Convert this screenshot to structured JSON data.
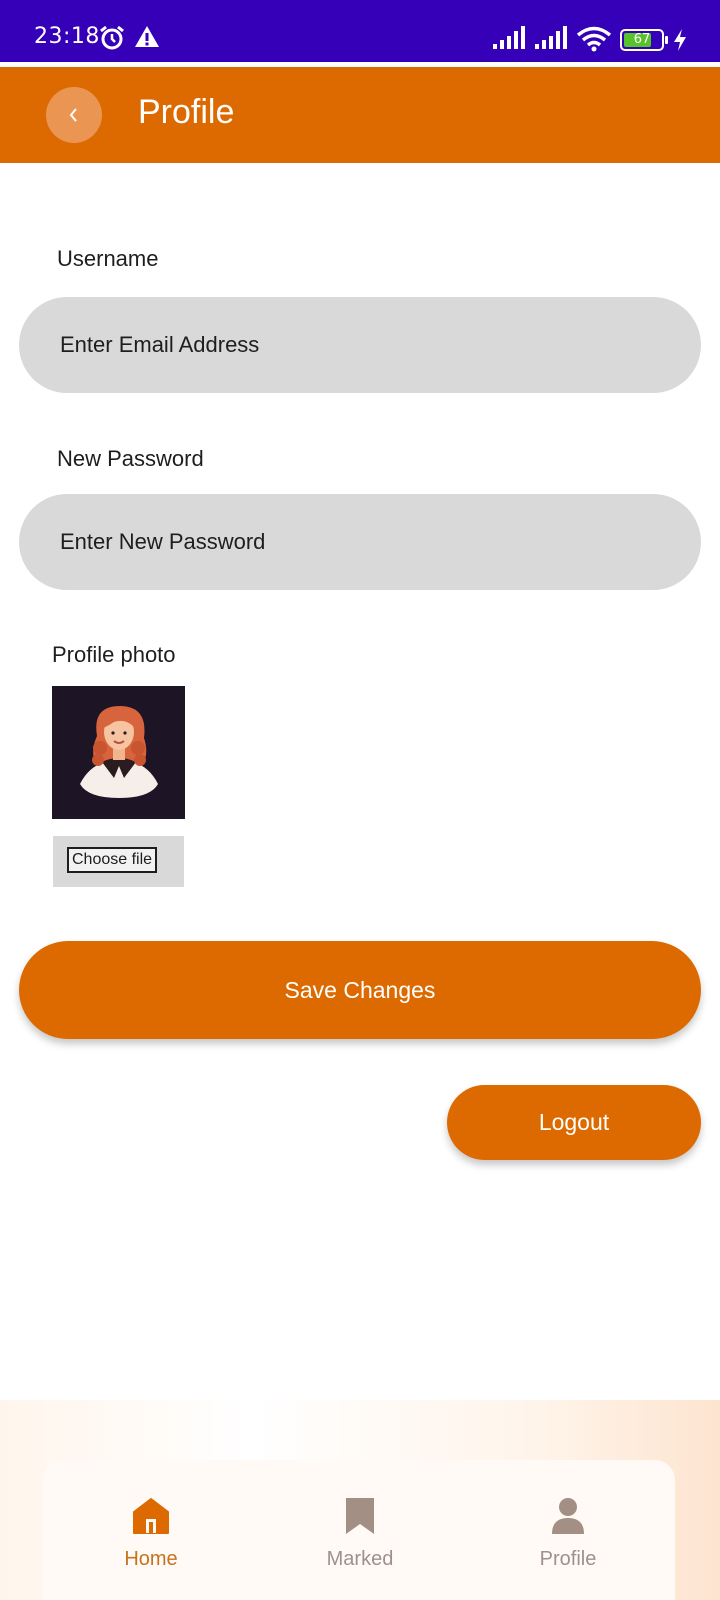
{
  "status_bar": {
    "time": "23:18",
    "battery_level": "67",
    "icons": [
      "alarm-icon",
      "warning-icon",
      "signal-icon",
      "signal-icon",
      "wifi-icon",
      "battery-icon",
      "charging-icon"
    ]
  },
  "header": {
    "title": "Profile",
    "back_icon": "chevron-left-icon"
  },
  "form": {
    "username_label": "Username",
    "username_placeholder": "Enter Email Address",
    "password_label": "New Password",
    "password_placeholder": "Enter New Password",
    "photo_label": "Profile photo",
    "choose_file_label": "Choose file"
  },
  "actions": {
    "save_label": "Save Changes",
    "logout_label": "Logout"
  },
  "bottom_nav": {
    "items": [
      {
        "label": "Home",
        "icon": "home-icon",
        "active": true
      },
      {
        "label": "Marked",
        "icon": "bookmark-icon",
        "active": false
      },
      {
        "label": "Profile",
        "icon": "person-icon",
        "active": false
      }
    ]
  },
  "colors": {
    "status_bar": "#3600b8",
    "primary": "#dd6a00",
    "field_bg": "#d9d9d9",
    "nav_active": "#c7731d",
    "nav_inactive": "#9e918a"
  }
}
